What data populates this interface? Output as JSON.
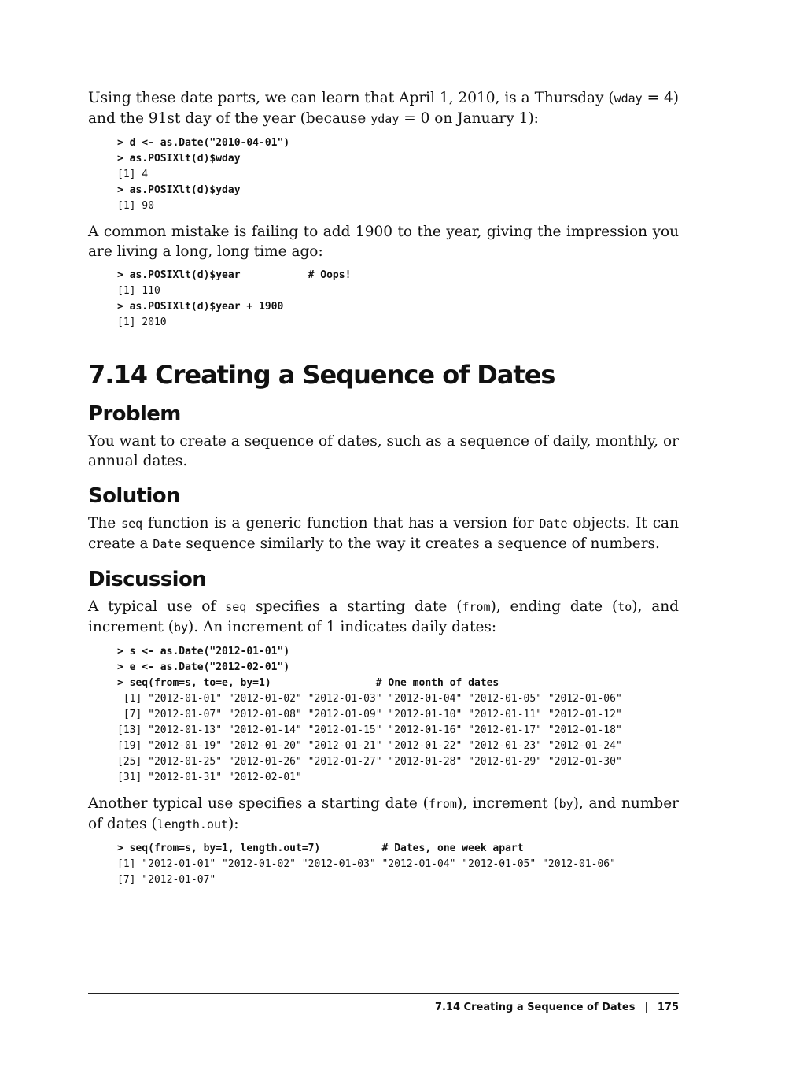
{
  "intro": {
    "p1": [
      "Using these date parts, we can learn that April 1, 2010, is a Thursday (",
      "wday",
      " = 4) and the 91st day of the year (because ",
      "yday",
      " = 0 on January 1):"
    ],
    "code1": [
      "> d <- as.Date(\"2010-04-01\")",
      "> as.POSIXlt(d)$wday",
      "[1] 4",
      "> as.POSIXlt(d)$yday",
      "[1] 90"
    ],
    "p2": "A common mistake is failing to add 1900 to the year, giving the impression you are living a long, long time ago:",
    "code2": [
      "> as.POSIXlt(d)$year           # Oops!",
      "[1] 110",
      "> as.POSIXlt(d)$year + 1900",
      "[1] 2010"
    ]
  },
  "section": {
    "title": "7.14  Creating a Sequence of Dates"
  },
  "problem": {
    "heading": "Problem",
    "text": "You want to create a sequence of dates, such as a sequence of daily, monthly, or annual dates."
  },
  "solution": {
    "heading": "Solution",
    "text": [
      "The ",
      "seq",
      " function is a generic function that has a version for ",
      "Date",
      " objects. It can create a ",
      "Date",
      " sequence similarly to the way it creates a sequence of numbers."
    ]
  },
  "discussion": {
    "heading": "Discussion",
    "p1": [
      "A typical use of ",
      "seq",
      " specifies a starting date (",
      "from",
      "), ending date (",
      "to",
      "), and increment (",
      "by",
      "). An increment of 1 indicates daily dates:"
    ],
    "code1": [
      "> s <- as.Date(\"2012-01-01\")",
      "> e <- as.Date(\"2012-02-01\")",
      "> seq(from=s, to=e, by=1)                 # One month of dates",
      " [1] \"2012-01-01\" \"2012-01-02\" \"2012-01-03\" \"2012-01-04\" \"2012-01-05\" \"2012-01-06\"",
      " [7] \"2012-01-07\" \"2012-01-08\" \"2012-01-09\" \"2012-01-10\" \"2012-01-11\" \"2012-01-12\"",
      "[13] \"2012-01-13\" \"2012-01-14\" \"2012-01-15\" \"2012-01-16\" \"2012-01-17\" \"2012-01-18\"",
      "[19] \"2012-01-19\" \"2012-01-20\" \"2012-01-21\" \"2012-01-22\" \"2012-01-23\" \"2012-01-24\"",
      "[25] \"2012-01-25\" \"2012-01-26\" \"2012-01-27\" \"2012-01-28\" \"2012-01-29\" \"2012-01-30\"",
      "[31] \"2012-01-31\" \"2012-02-01\""
    ],
    "p2": [
      "Another typical use specifies a starting date (",
      "from",
      "), increment (",
      "by",
      "), and number of dates (",
      "length.out",
      "):"
    ],
    "code2": [
      "> seq(from=s, by=1, length.out=7)          # Dates, one week apart",
      "[1] \"2012-01-01\" \"2012-01-02\" \"2012-01-03\" \"2012-01-04\" \"2012-01-05\" \"2012-01-06\"",
      "[7] \"2012-01-07\""
    ]
  },
  "footer": {
    "running_title": "7.14  Creating a Sequence of Dates",
    "separator": "|",
    "page_number": "175"
  }
}
